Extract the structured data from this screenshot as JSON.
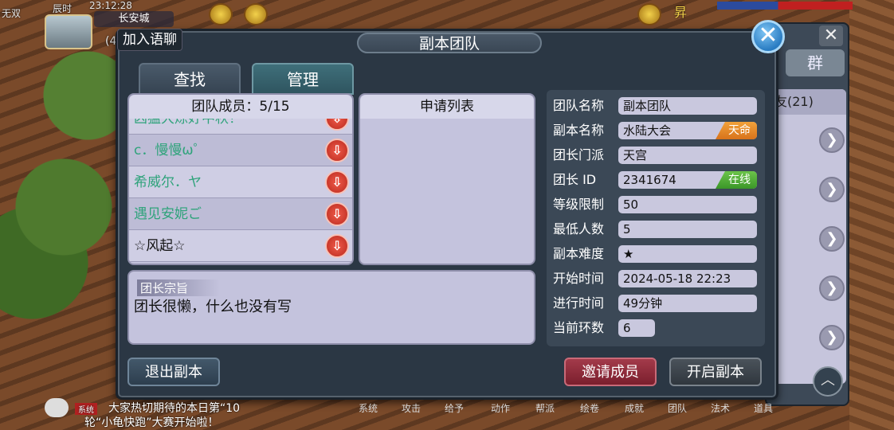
{
  "hud": {
    "player_label": "无双",
    "time_label": "辰时",
    "time_value": "23:12:28",
    "map_name": "长安城",
    "level_hint": "(4",
    "name_right": "昇"
  },
  "join_chat_label": "加入语聊",
  "dialog": {
    "title": "副本团队",
    "close_glyph": "✕",
    "tabs": [
      {
        "label": "查找"
      },
      {
        "label": "管理"
      }
    ],
    "members": {
      "header": "团队成员：5/15",
      "rows": [
        {
          "name": "凶猛大炼好中秋！",
          "color": "green"
        },
        {
          "name": "c．慢慢ω゜",
          "color": "green"
        },
        {
          "name": "希威尔．ヤ",
          "color": "green"
        },
        {
          "name": "遇见安妮ご",
          "color": "green"
        },
        {
          "name": "☆风起☆",
          "color": "black"
        }
      ],
      "kick_glyph": "⇩"
    },
    "apply": {
      "header": "申请列表"
    },
    "motto": {
      "label": "团长宗旨",
      "text": "团长很懒，什么也没有写"
    },
    "info": {
      "rows": [
        {
          "label": "团队名称",
          "value": "副本团队",
          "tag": ""
        },
        {
          "label": "副本名称",
          "value": "水陆大会",
          "tag": "天命"
        },
        {
          "label": "团长门派",
          "value": "天宫",
          "tag": ""
        },
        {
          "label": "团长 ID",
          "value": "2341674",
          "tag": "在线"
        },
        {
          "label": "等级限制",
          "value": "50",
          "tag": ""
        },
        {
          "label": "最低人数",
          "value": "5",
          "tag": ""
        },
        {
          "label": "副本难度",
          "value": "★",
          "tag": ""
        },
        {
          "label": "开始时间",
          "value": "2024-05-18 22:23",
          "tag": ""
        },
        {
          "label": "进行时间",
          "value": "49分钟",
          "tag": ""
        },
        {
          "label": "当前环数",
          "value": "6",
          "tag": ""
        }
      ]
    },
    "buttons": {
      "exit": "退出副本",
      "invite": "邀请成员",
      "start": "开启副本"
    }
  },
  "back_panel": {
    "close_glyph": "✕",
    "tab": "群",
    "list_header": "友(21)",
    "arrow_glyph": "❯",
    "up_glyph": "︿"
  },
  "chat": {
    "sys_tag": "系统",
    "line1": "大家热切期待的本日第“10",
    "line2": "轮“小龟快跑”大赛开始啦！"
  },
  "bottom_menu": [
    "系统",
    "攻击",
    "给予",
    "动作",
    "帮派",
    "绘卷",
    "成就",
    "团队",
    "法术",
    "道具"
  ],
  "colors": {
    "member_green": "#2fa37b",
    "tag_orange": "#e8892a",
    "tag_green": "#4caf35",
    "invite_red": "#8f2a3a"
  }
}
